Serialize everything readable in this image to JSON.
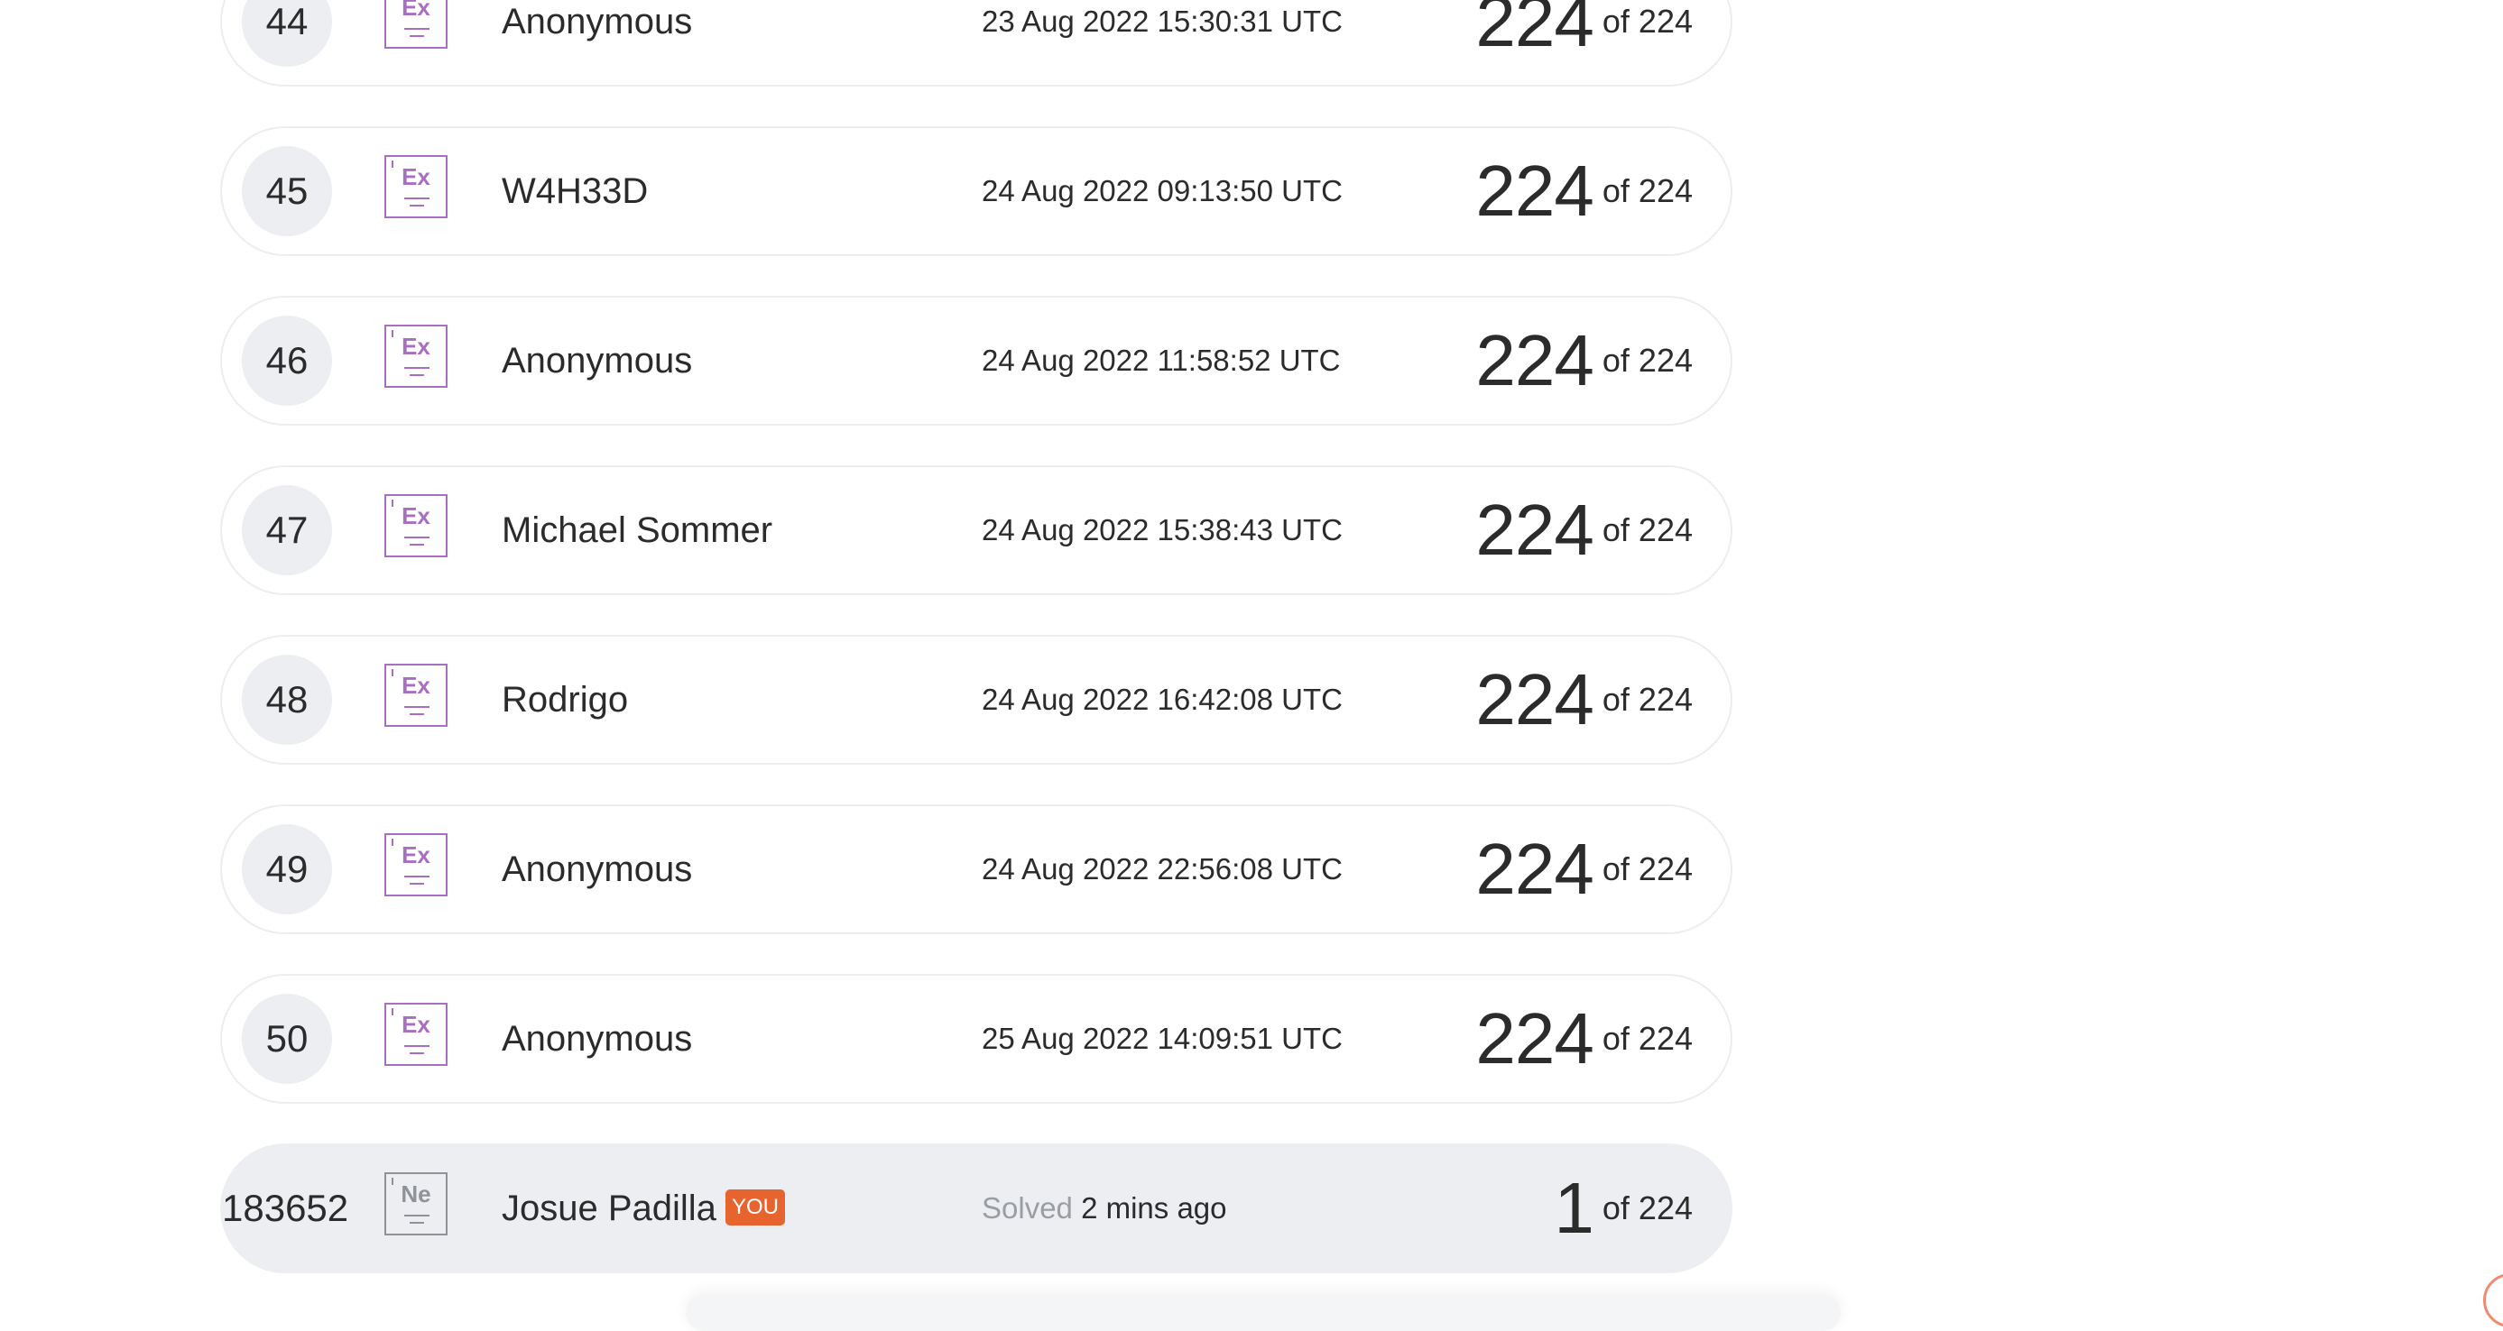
{
  "leaderboard": {
    "rows": [
      {
        "rank": "44",
        "symbol": "Ex",
        "name": "Anonymous",
        "time": "23 Aug 2022 15:30:31 UTC",
        "score": "224",
        "of_total": "of 224"
      },
      {
        "rank": "45",
        "symbol": "Ex",
        "name": "W4H33D",
        "time": "24 Aug 2022 09:13:50 UTC",
        "score": "224",
        "of_total": "of 224"
      },
      {
        "rank": "46",
        "symbol": "Ex",
        "name": "Anonymous",
        "time": "24 Aug 2022 11:58:52 UTC",
        "score": "224",
        "of_total": "of 224"
      },
      {
        "rank": "47",
        "symbol": "Ex",
        "name": "Michael Sommer",
        "time": "24 Aug 2022 15:38:43 UTC",
        "score": "224",
        "of_total": "of 224"
      },
      {
        "rank": "48",
        "symbol": "Ex",
        "name": "Rodrigo",
        "time": "24 Aug 2022 16:42:08 UTC",
        "score": "224",
        "of_total": "of 224"
      },
      {
        "rank": "49",
        "symbol": "Ex",
        "name": "Anonymous",
        "time": "24 Aug 2022 22:56:08 UTC",
        "score": "224",
        "of_total": "of 224"
      },
      {
        "rank": "50",
        "symbol": "Ex",
        "name": "Anonymous",
        "time": "25 Aug 2022 14:09:51 UTC",
        "score": "224",
        "of_total": "of 224"
      }
    ],
    "current_user": {
      "rank": "183652",
      "symbol": "Ne",
      "name": "Josue Padilla",
      "you_badge": "YOU",
      "solved_label": "Solved",
      "solved_time": "2 mins ago",
      "score": "1",
      "of_total": "of 224"
    }
  },
  "colors": {
    "expert_badge": "#a86ec0",
    "newbie_badge": "#8f9398",
    "you_badge": "#e8642f",
    "row_border": "#ecedef",
    "current_row_bg": "#eceef1"
  },
  "icons": {
    "expert": "expert-level-badge-icon",
    "newbie": "newbie-level-badge-icon"
  }
}
